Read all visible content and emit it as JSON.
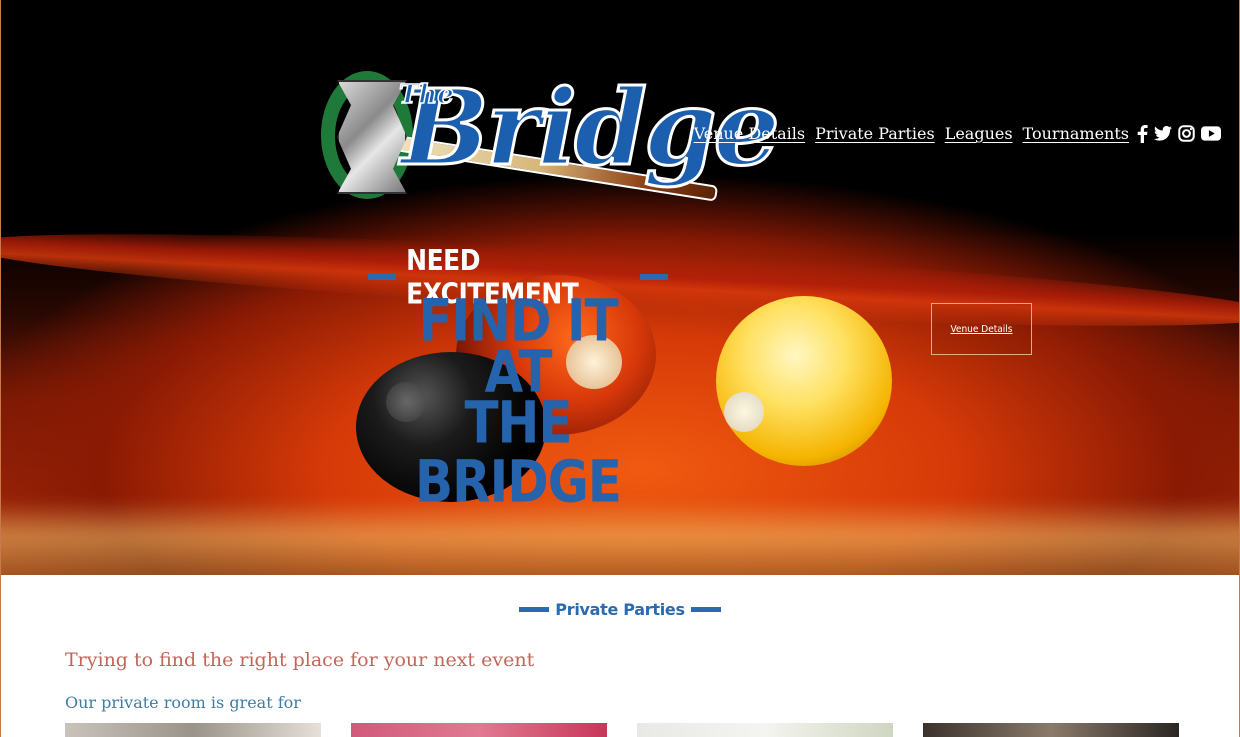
{
  "brand": {
    "logo_small": "The",
    "logo_word": "Bridge"
  },
  "nav": {
    "items": [
      {
        "label": "Venue Details"
      },
      {
        "label": "Private Parties"
      },
      {
        "label": "Leagues"
      },
      {
        "label": "Tournaments"
      }
    ],
    "social_icons": [
      "facebook-icon",
      "twitter-icon",
      "instagram-icon",
      "youtube-icon"
    ]
  },
  "hero": {
    "tagline": "NEED EXCITEMENT",
    "headline": {
      "line1": "FIND IT",
      "line2": "AT",
      "line3": "THE BRIDGE"
    },
    "button_label": "Venue Details"
  },
  "section": {
    "heading": "Private Parties",
    "intro": "Trying to find the right place for your next event",
    "subintro": "Our private room is great for"
  },
  "colors": {
    "accent_blue": "#2a6ab0",
    "headline_blue": "#2563ad",
    "intro_red": "#c2665a",
    "subintro_blue": "#3d7da6",
    "logo_green": "#1f7a3a"
  }
}
